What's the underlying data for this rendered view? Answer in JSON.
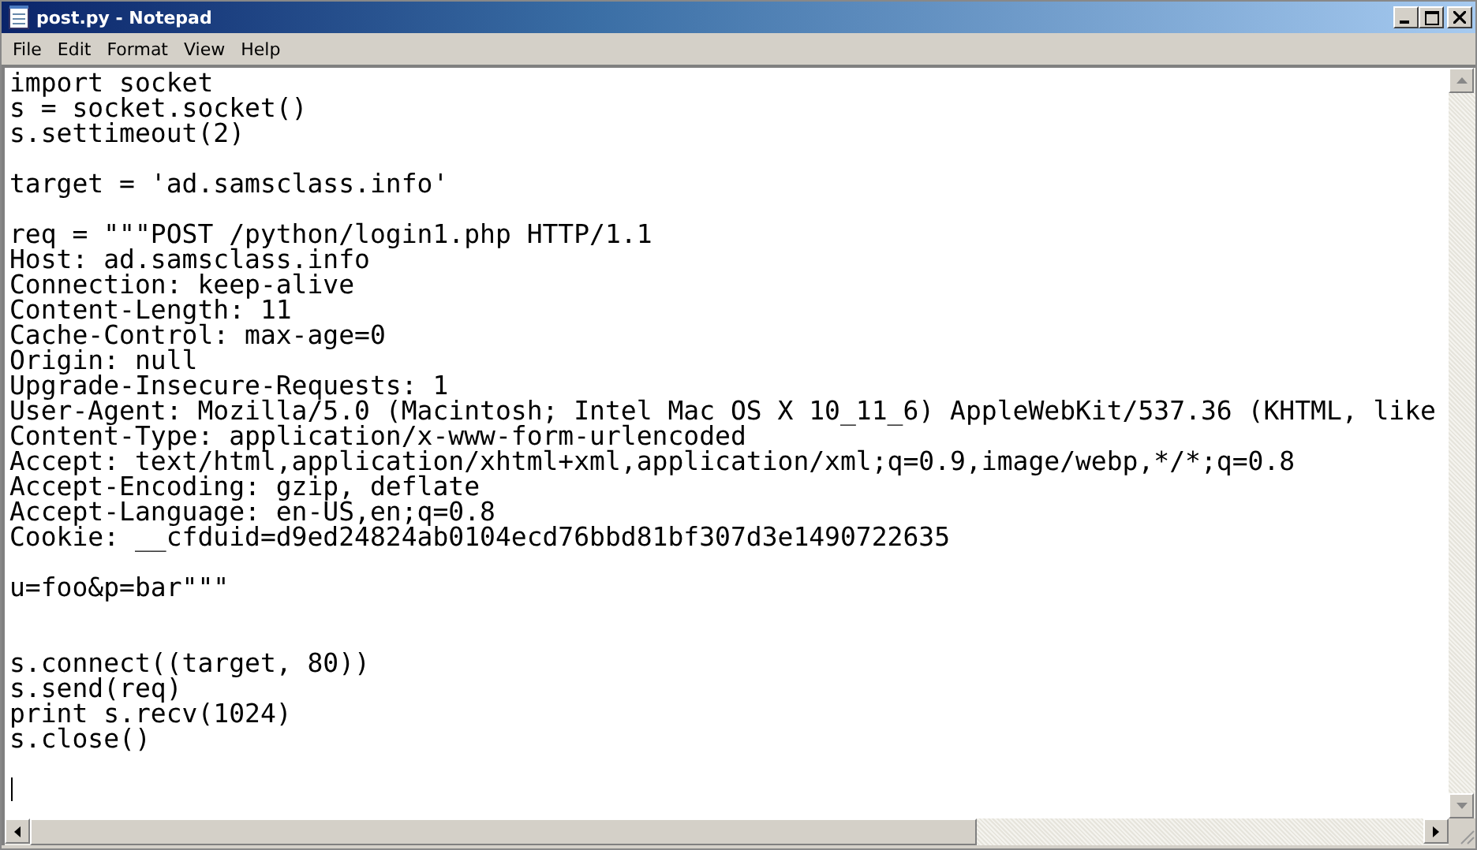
{
  "window": {
    "title": "post.py - Notepad"
  },
  "menu": [
    "File",
    "Edit",
    "Format",
    "View",
    "Help"
  ],
  "editor": {
    "text": "import socket\ns = socket.socket()\ns.settimeout(2)\n\ntarget = 'ad.samsclass.info'\n\nreq = \"\"\"POST /python/login1.php HTTP/1.1\nHost: ad.samsclass.info\nConnection: keep-alive\nContent-Length: 11\nCache-Control: max-age=0\nOrigin: null\nUpgrade-Insecure-Requests: 1\nUser-Agent: Mozilla/5.0 (Macintosh; Intel Mac OS X 10_11_6) AppleWebKit/537.36 (KHTML, like\nContent-Type: application/x-www-form-urlencoded\nAccept: text/html,application/xhtml+xml,application/xml;q=0.9,image/webp,*/*;q=0.8\nAccept-Encoding: gzip, deflate\nAccept-Language: en-US,en;q=0.8\nCookie: __cfduid=d9ed24824ab0104ecd76bbd81bf307d3e1490722635\n\nu=foo&p=bar\"\"\"\n\n\ns.connect((target, 80))\ns.send(req)\nprint s.recv(1024)\ns.close()\n\n"
  }
}
